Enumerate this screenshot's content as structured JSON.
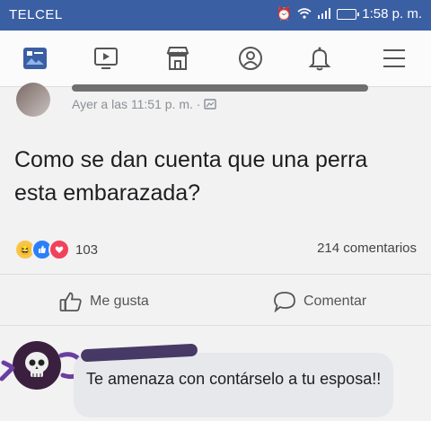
{
  "status_bar": {
    "carrier": "TELCEL",
    "time": "1:58 p. m."
  },
  "nav": {
    "items": [
      {
        "icon": "news-feed-icon",
        "active": true
      },
      {
        "icon": "video-icon"
      },
      {
        "icon": "marketplace-icon"
      },
      {
        "icon": "profile-icon"
      },
      {
        "icon": "notifications-bell-icon"
      },
      {
        "icon": "menu-icon"
      }
    ],
    "accent": "#3b5fa3"
  },
  "post": {
    "timestamp": "Ayer a las 11:51 p. m. ·",
    "text": "Como se dan cuenta que una perra esta embarazada?",
    "reaction_count": "103",
    "comments_count": "214 comentarios",
    "like_label": "Me gusta",
    "comment_label": "Comentar"
  },
  "comment": {
    "text": "Te amenaza con contárselo a tu esposa!!"
  }
}
